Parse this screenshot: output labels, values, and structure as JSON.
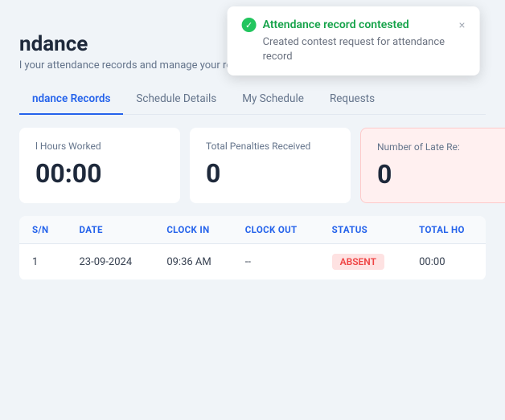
{
  "toast": {
    "title": "Attendance record contested",
    "body": "Created contest request for attendance record",
    "close_label": "×"
  },
  "page": {
    "title": "ndance",
    "subtitle": "l your attendance records and manage your requests here"
  },
  "tabs": [
    {
      "label": "ndance Records",
      "active": true
    },
    {
      "label": "Schedule Details",
      "active": false
    },
    {
      "label": "My Schedule",
      "active": false
    },
    {
      "label": "Requests",
      "active": false
    }
  ],
  "stats": [
    {
      "label": "l Hours Worked",
      "value": "00:00",
      "variant": "normal"
    },
    {
      "label": "Total Penalties Received",
      "value": "0",
      "variant": "normal"
    },
    {
      "label": "Number of Late Re:",
      "value": "0",
      "variant": "pink"
    }
  ],
  "table": {
    "columns": [
      "S/N",
      "DATE",
      "CLOCK IN",
      "CLOCK OUT",
      "STATUS",
      "TOTAL HO"
    ],
    "rows": [
      {
        "sn": "1",
        "date": "23-09-2024",
        "clock_in": "09:36 AM",
        "clock_out": "--",
        "status": "ABSENT",
        "total_hours": "00:00"
      }
    ]
  }
}
